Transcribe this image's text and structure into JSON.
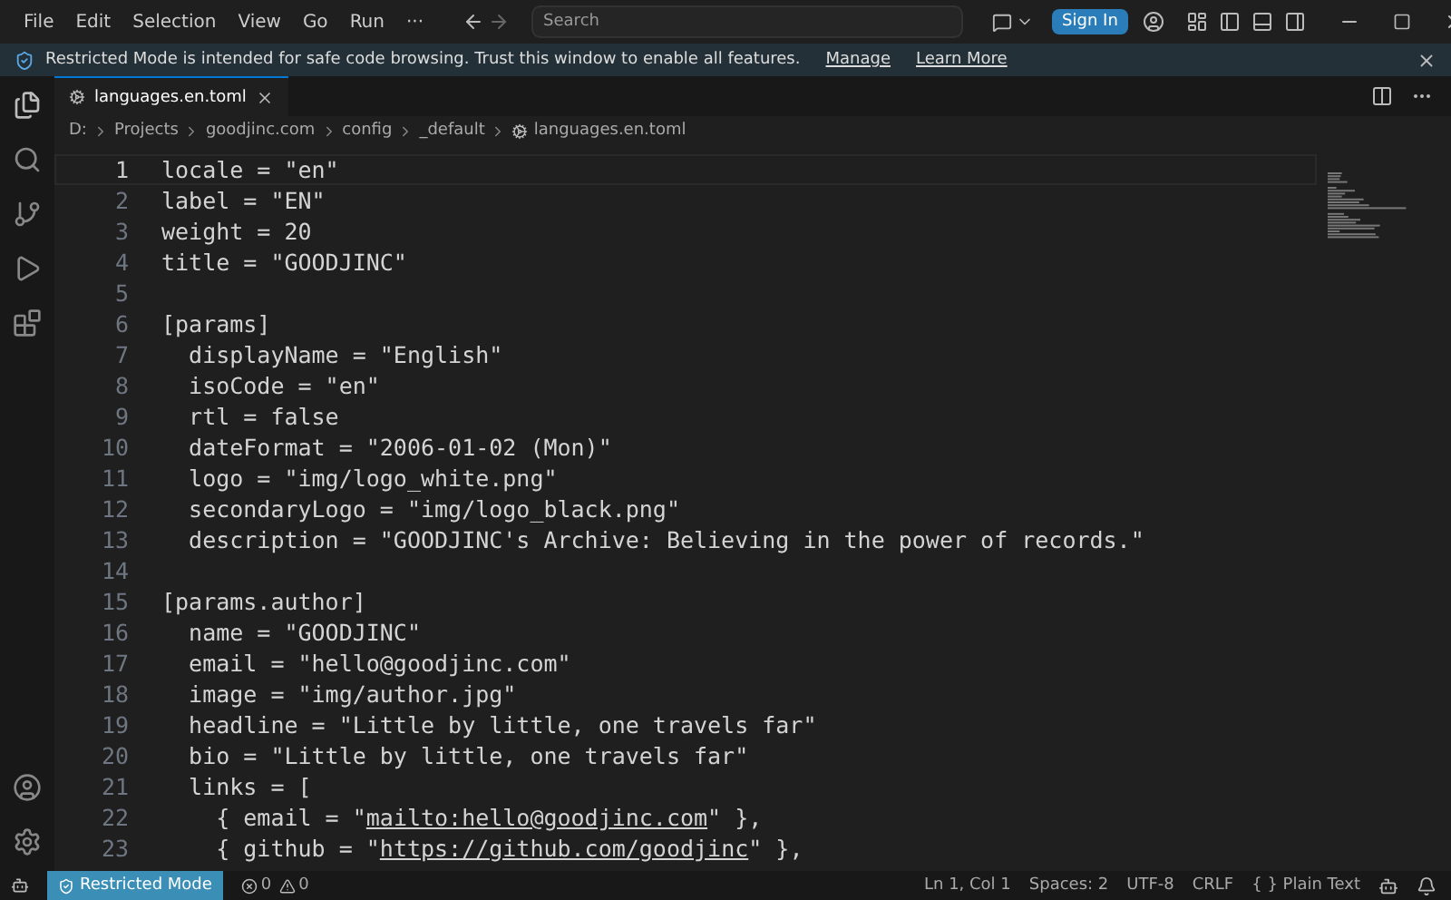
{
  "menu": [
    "File",
    "Edit",
    "Selection",
    "View",
    "Go",
    "Run",
    "···"
  ],
  "search": {
    "placeholder": "Search"
  },
  "sign_in": "Sign In",
  "banner": {
    "text": "Restricted Mode is intended for safe code browsing. Trust this window to enable all features.",
    "links": [
      "Manage",
      "Learn More"
    ]
  },
  "tabs": [
    {
      "label": "languages.en.toml",
      "selected": true
    }
  ],
  "breadcrumb": [
    "D:",
    "Projects",
    "goodjinc.com",
    "config",
    "_default",
    "languages.en.toml"
  ],
  "lines": [
    {
      "number": "1",
      "current": true,
      "parts": [
        {
          "text": "locale = \"en\""
        }
      ]
    },
    {
      "number": "2",
      "current": false,
      "parts": [
        {
          "text": "label = \"EN\""
        }
      ]
    },
    {
      "number": "3",
      "current": false,
      "parts": [
        {
          "text": "weight = 20"
        }
      ]
    },
    {
      "number": "4",
      "current": false,
      "parts": [
        {
          "text": "title = \"GOODJINC\""
        }
      ]
    },
    {
      "number": "5",
      "current": false
    },
    {
      "number": "6",
      "current": false,
      "parts": [
        {
          "text": "[params]"
        }
      ]
    },
    {
      "number": "7",
      "current": false,
      "parts": [
        {
          "text": "  displayName = \"English\""
        }
      ]
    },
    {
      "number": "8",
      "current": false,
      "parts": [
        {
          "text": "  isoCode = \"en\""
        }
      ]
    },
    {
      "number": "9",
      "current": false,
      "parts": [
        {
          "text": "  rtl = false"
        }
      ]
    },
    {
      "number": "10",
      "current": false,
      "parts": [
        {
          "text": "  dateFormat = \"2006-01-02 (Mon)\""
        }
      ]
    },
    {
      "number": "11",
      "current": false,
      "parts": [
        {
          "text": "  logo = \"img/logo_white.png\""
        }
      ]
    },
    {
      "number": "12",
      "current": false,
      "parts": [
        {
          "text": "  secondaryLogo = \"img/logo_black.png\""
        }
      ]
    },
    {
      "number": "13",
      "current": false,
      "parts": [
        {
          "text": "  description = \"GOODJINC's Archive: Believing in the power of records.\""
        }
      ]
    },
    {
      "number": "14",
      "current": false
    },
    {
      "number": "15",
      "current": false,
      "parts": [
        {
          "text": "[params.author]"
        }
      ]
    },
    {
      "number": "16",
      "current": false,
      "parts": [
        {
          "text": "  name = \"GOODJINC\""
        }
      ]
    },
    {
      "number": "17",
      "current": false,
      "parts": [
        {
          "text": "  email = \"hello@goodjinc.com\""
        }
      ]
    },
    {
      "number": "18",
      "current": false,
      "parts": [
        {
          "text": "  image = \"img/author.jpg\""
        }
      ]
    },
    {
      "number": "19",
      "current": false,
      "parts": [
        {
          "text": "  headline = \"Little by little, one travels far\""
        }
      ]
    },
    {
      "number": "20",
      "current": false,
      "parts": [
        {
          "text": "  bio = \"Little by little, one travels far\""
        }
      ]
    },
    {
      "number": "21",
      "current": false,
      "parts": [
        {
          "text": "  links = ["
        }
      ]
    },
    {
      "number": "22",
      "current": false,
      "parts": [
        {
          "text": "    { email = \""
        },
        {
          "text": "mailto:hello@goodjinc.com",
          "link": true
        },
        {
          "text": "\" },"
        }
      ]
    },
    {
      "number": "23",
      "current": false,
      "parts": [
        {
          "text": "    { github = \""
        },
        {
          "text": "https://github.com/goodjinc",
          "link": true
        },
        {
          "text": "\" },"
        }
      ]
    }
  ],
  "status": {
    "mode": "Restricted Mode",
    "errors": "0",
    "warnings": "0",
    "items": [
      "Ln 1, Col 1",
      "Spaces: 2",
      "UTF-8",
      "CRLF",
      "{ } Plain Text"
    ]
  }
}
